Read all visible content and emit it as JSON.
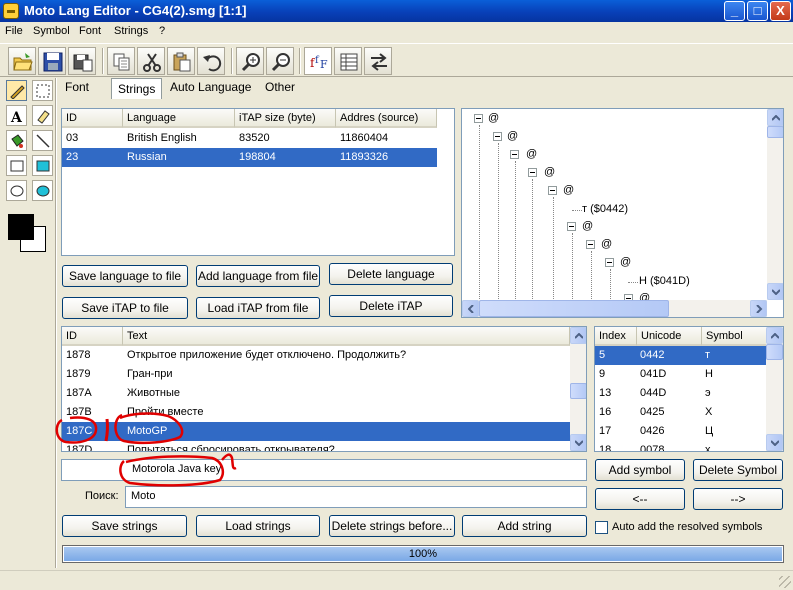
{
  "window": {
    "title": "Moto Lang Editor - CG4(2).smg [1:1]",
    "min": "_",
    "max": "□",
    "close": "X"
  },
  "menu": [
    "File",
    "Symbol",
    "Font",
    "Strings",
    "?"
  ],
  "toolbar": {
    "icons": [
      "open-folder-icon",
      "save-icon",
      "save-as-icon",
      "copy-icon",
      "cut-icon",
      "paste-icon",
      "undo-icon",
      "zoom-in-icon",
      "zoom-out-icon",
      "font-icon",
      "table-icon",
      "swap-icon"
    ]
  },
  "tabs": [
    "Font",
    "Strings",
    "Auto Language",
    "Other"
  ],
  "active_tab": "Strings",
  "languages": {
    "headers": [
      "ID",
      "Language",
      "iTAP size (byte)",
      "Addres (source)"
    ],
    "rows": [
      [
        "03",
        "British English",
        "83520",
        "11860404"
      ],
      [
        "23",
        "Russian",
        "198804",
        "11893326"
      ]
    ],
    "selected_row": 1
  },
  "lang_buttons": {
    "save_language": "Save language to file",
    "add_language": "Add language from file",
    "delete_language": "Delete language",
    "save_itap": "Save iTAP to file",
    "load_itap": "Load iTAP from file",
    "delete_itap": "Delete iTAP"
  },
  "tree": {
    "nodes": [
      "@",
      "@",
      "@",
      "@",
      "@",
      "т ($0442)",
      "@",
      "@",
      "@",
      "Н ($041D)",
      "@"
    ]
  },
  "strings": {
    "headers": [
      "ID",
      "Text"
    ],
    "rows": [
      [
        "1878",
        "Открытое приложение будет отключено. Продолжить?"
      ],
      [
        "1879",
        "Гран-при"
      ],
      [
        "187A",
        "Животные"
      ],
      [
        "187B",
        "Пройти вместе"
      ],
      [
        "187C",
        "MotoGP"
      ],
      [
        "187D",
        "Попытаться сбросировать открывателя?"
      ]
    ],
    "selected_row": 4
  },
  "symbols": {
    "headers": [
      "Index",
      "Unicode",
      "Symbol"
    ],
    "rows": [
      [
        "5",
        "0442",
        "т"
      ],
      [
        "9",
        "041D",
        "Н"
      ],
      [
        "13",
        "044D",
        "э"
      ],
      [
        "16",
        "0425",
        "Х"
      ],
      [
        "17",
        "0426",
        "Ц"
      ],
      [
        "18",
        "0078",
        "х"
      ]
    ],
    "selected_row": 0
  },
  "edit_field": {
    "value": "Motorola Java key"
  },
  "search": {
    "label": "Поиск:",
    "value": "Moto"
  },
  "symbol_buttons": {
    "add": "Add symbol",
    "delete": "Delete Symbol",
    "prev": "<--",
    "next": "-->"
  },
  "string_buttons": {
    "save": "Save strings",
    "load": "Load strings",
    "delete_before": "Delete strings before...",
    "add": "Add string"
  },
  "auto_add": {
    "label": "Auto add the resolved symbols",
    "checked": false
  },
  "progress": {
    "value": 1.0,
    "text": "100%"
  },
  "colors": {
    "selection": "#316ac5",
    "annotation": "#e00000",
    "titlebar": "#0a5fd8"
  }
}
